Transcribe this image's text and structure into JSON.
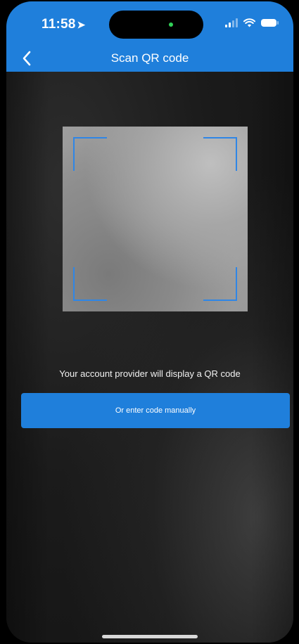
{
  "status_bar": {
    "time": "11:58",
    "location_icon": "location-arrow-icon",
    "signal_icon": "cellular-signal-icon",
    "wifi_icon": "wifi-icon",
    "battery_icon": "battery-icon"
  },
  "header": {
    "back_icon": "chevron-left-icon",
    "title": "Scan QR code",
    "background_color": "#1f7fdb"
  },
  "scanner": {
    "instruction": "Your account provider will display a QR code",
    "frame_color": "#2f86e6"
  },
  "actions": {
    "manual_entry_label": "Or enter code manually",
    "button_color": "#1f7fdb"
  }
}
